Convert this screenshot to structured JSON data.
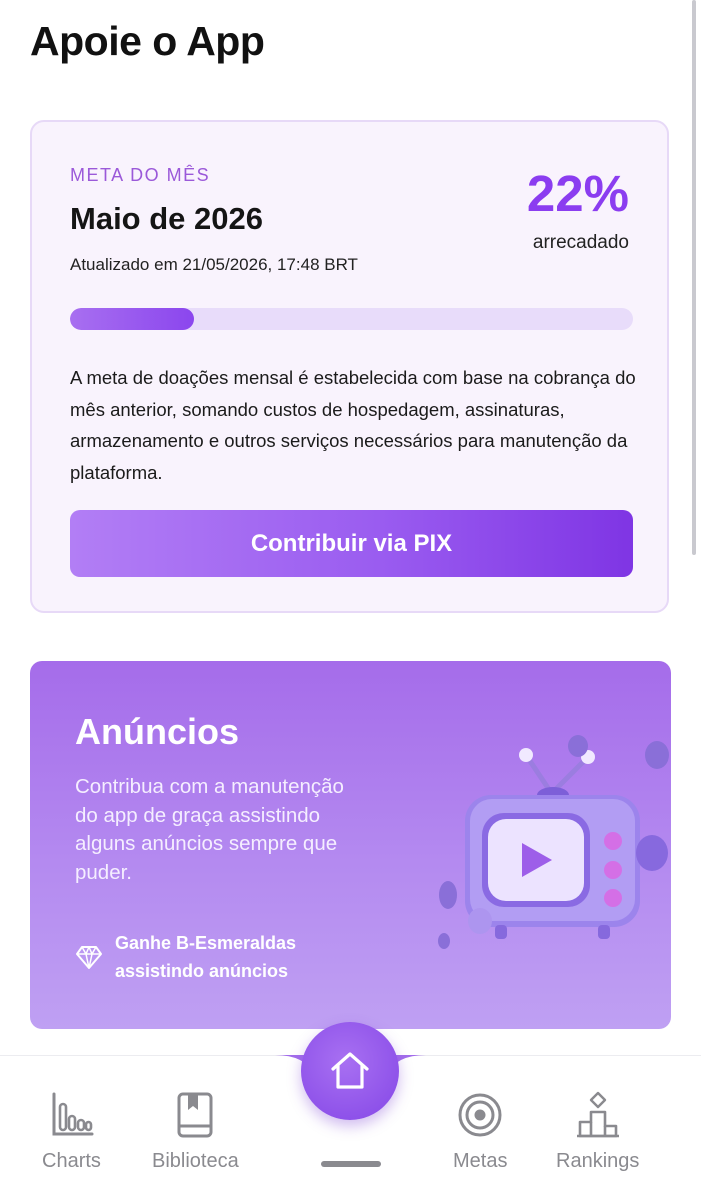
{
  "page": {
    "title": "Apoie o App"
  },
  "goal_card": {
    "eyebrow": "META DO MÊS",
    "month": "Maio de 2026",
    "updated": "Atualizado em 21/05/2026, 17:48 BRT",
    "percent_label": "22%",
    "percent_caption": "arrecadado",
    "progress_fraction": 0.22,
    "description": "A meta de doações mensal é estabelecida com base na cobrança do mês anterior, somando custos de hospedagem, assinaturas, armazenamento e outros serviços necessários para manutenção da plataforma.",
    "button_label": "Contribuir via PIX"
  },
  "ads_card": {
    "title": "Anúncios",
    "text": "Contribua com a manutenção do app de graça assistindo alguns anúncios sempre que puder.",
    "reward_text": "Ganhe B-Esmeraldas assistindo anúncios",
    "reward_icon": "gem-icon",
    "illustration": "tv-icon"
  },
  "bottom_nav": {
    "items": [
      {
        "label": "Charts",
        "icon": "bar-chart-icon"
      },
      {
        "label": "Biblioteca",
        "icon": "book-icon"
      },
      {
        "label": "Metas",
        "icon": "target-icon"
      },
      {
        "label": "Rankings",
        "icon": "podium-icon"
      }
    ],
    "home_icon": "home-icon"
  },
  "colors": {
    "accent": "#8b3df0",
    "card_background": "#f9f3fd",
    "ads_background": "#a56cea",
    "nav_inactive": "#8a8a8f"
  }
}
